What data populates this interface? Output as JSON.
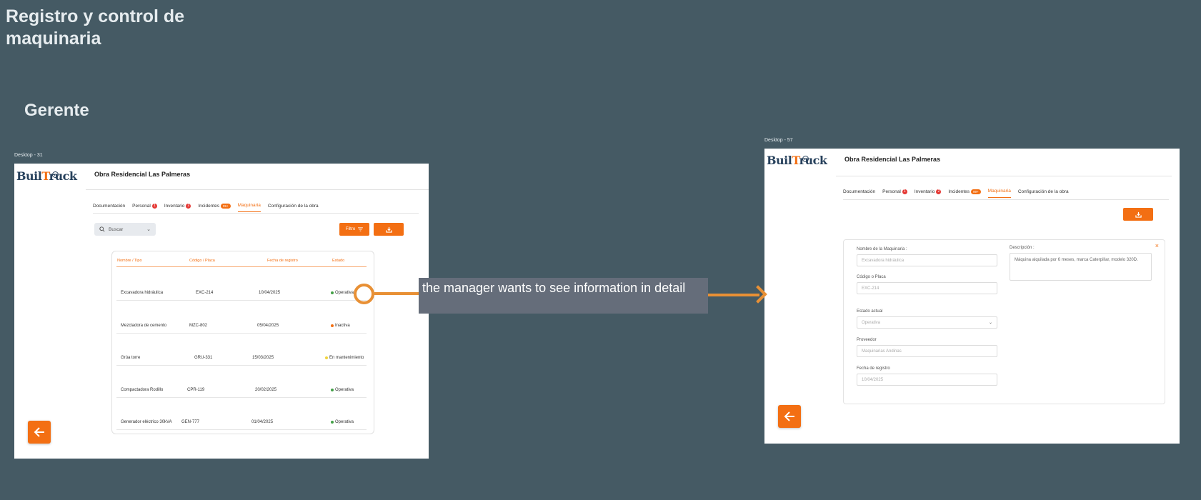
{
  "board": {
    "title": "Registro y control de maquinaria",
    "role": "Gerente",
    "annotation": "the manager wants to see information in detail"
  },
  "colors": {
    "background": "#455a64",
    "accent": "#f36f13",
    "connector": "#e89035",
    "callout": "#656d7a"
  },
  "frameA": {
    "label": "Desktop - 31",
    "logo": {
      "pre": "Buil",
      "t": "T",
      "post": "ruck"
    },
    "project": "Obra Residencial Las Palmeras",
    "tabs": [
      {
        "label": "Documentación"
      },
      {
        "label": "Personal",
        "badge": "1"
      },
      {
        "label": "Inventario",
        "badge": "2"
      },
      {
        "label": "Incidentes",
        "badge": "99+"
      },
      {
        "label": "Maquinaria",
        "active": true
      },
      {
        "label": "Configuración de la obra"
      }
    ],
    "search_placeholder": "Buscar",
    "filter_label": "Filtro",
    "columns": [
      "Nombre / Tipo",
      "Código / Placa",
      "Fecha de registro",
      "Estado"
    ],
    "rows": [
      {
        "name": "Excavadora hidráulica",
        "code": "EXC-214",
        "date": "10/04/2025",
        "status": "Operativa",
        "color": "#43a047"
      },
      {
        "name": "Mezcladora de cemento",
        "code": "MZC-802",
        "date": "05/04/2025",
        "status": "Inactiva",
        "color": "#f36f13"
      },
      {
        "name": "Grúa torre",
        "code": "GRU-331",
        "date": "15/03/2025",
        "status": "En mantenimiento",
        "color": "#f0d33c"
      },
      {
        "name": "Compactadora Rodillo",
        "code": "CPR-119",
        "date": "20/02/2025",
        "status": "Operativa",
        "color": "#43a047"
      },
      {
        "name": "Generador eléctrico 30kVA",
        "code": "GEN-777",
        "date": "01/04/2025",
        "status": "Operativa",
        "color": "#43a047"
      }
    ]
  },
  "frameB": {
    "label": "Desktop - 57",
    "logo": {
      "pre": "Buil",
      "t": "T",
      "post": "ruck"
    },
    "project": "Obra Residencial Las Palmeras",
    "tabs": [
      {
        "label": "Documentación"
      },
      {
        "label": "Personal",
        "badge": "1"
      },
      {
        "label": "Inventario",
        "badge": "2"
      },
      {
        "label": "Incidentes",
        "badge": "99+"
      },
      {
        "label": "Maquinaria",
        "active": true
      },
      {
        "label": "Configuración de la obra"
      }
    ],
    "form": {
      "name_label": "Nombre de la Maquinaria :",
      "name_value": "Excavadora hidráulica",
      "code_label": "Código o Placa",
      "code_value": "EXC-214",
      "state_label": "Estado actual",
      "state_value": "Operativa",
      "provider_label": "Proveedor",
      "provider_value": "Maquinarias Andinas",
      "date_label": "Fecha de registro",
      "date_value": "10/04/2025",
      "description_label": "Descripción :",
      "description_value": "Máquina alquilada por 6 meses, marca Caterpillar, modelo 320D.",
      "close": "×"
    }
  }
}
